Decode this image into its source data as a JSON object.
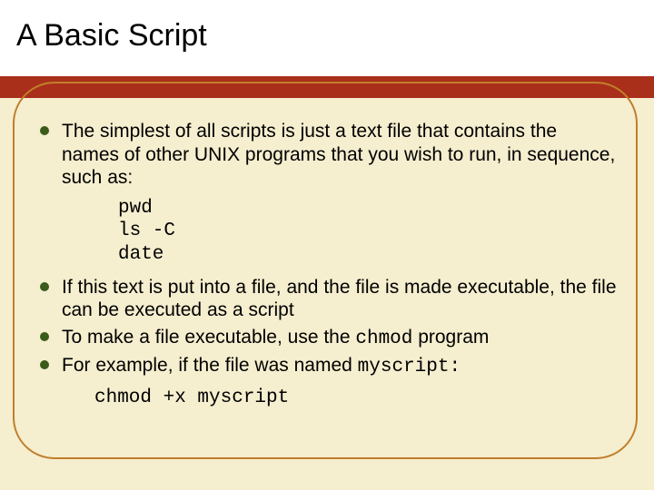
{
  "header": {
    "title": "A Basic Script"
  },
  "section1": {
    "bullet1": "The simplest of all scripts is just a text file that contains the names of other UNIX programs that you wish to run, in sequence, such as:"
  },
  "code1": {
    "line1": "pwd",
    "line2": "ls -C",
    "line3": "date"
  },
  "section2": {
    "bullet1": "If this text is put into a file, and the file is made executable, the file can be executed as a script",
    "bullet2_a": "To make a file executable, use the ",
    "bullet2_cmd": "chmod",
    "bullet2_b": " program",
    "bullet3_a": "For example, if the file was named ",
    "bullet3_cmd": "myscript",
    "bullet3_b": ":"
  },
  "code2": {
    "line1": "chmod +x myscript"
  }
}
